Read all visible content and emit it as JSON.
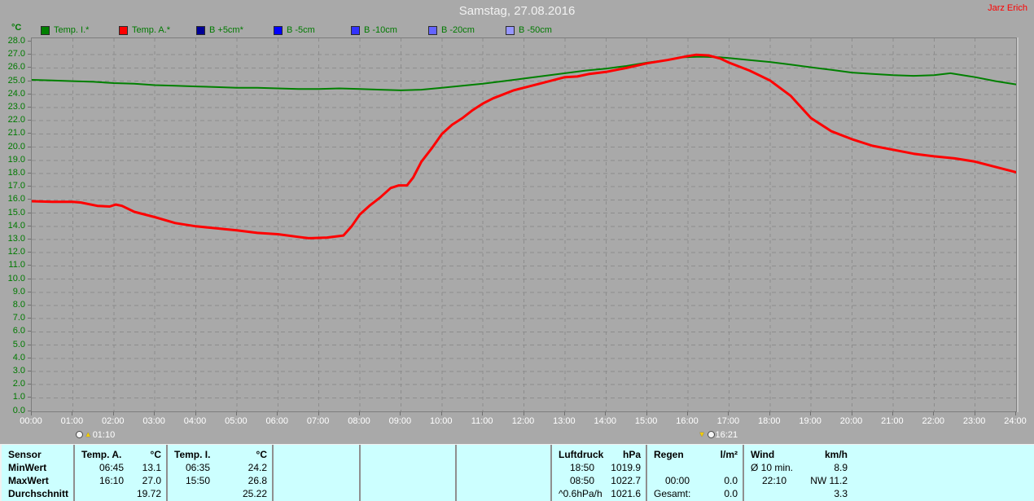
{
  "header": {
    "title": "Samstag, 27.08.2016",
    "user": "Jarz Erich"
  },
  "legend": {
    "axis_unit": "°C",
    "items": [
      {
        "label": "Temp. I.*",
        "color": "#008000"
      },
      {
        "label": "Temp. A.*",
        "color": "#ff0000"
      },
      {
        "label": "B +5cm*",
        "color": "#000096"
      },
      {
        "label": "B -5cm",
        "color": "#0000ff"
      },
      {
        "label": "B -10cm",
        "color": "#3232ff"
      },
      {
        "label": "B -20cm",
        "color": "#6464ff"
      },
      {
        "label": "B -50cm",
        "color": "#9696ff"
      }
    ]
  },
  "glyphs": {
    "up": "▲",
    "down": "▼"
  },
  "chart_data": {
    "type": "line",
    "title": "Samstag, 27.08.2016",
    "ylabel": "°C",
    "ylim": [
      0,
      28
    ],
    "y_tick_step": 1,
    "xlim_hours": [
      0,
      24
    ],
    "grid": "dashed",
    "legend_position": "top",
    "y_tick_labels": [
      "28.0",
      "27.0",
      "26.0",
      "25.0",
      "24.0",
      "23.0",
      "22.0",
      "21.0",
      "20.0",
      "19.0",
      "18.0",
      "17.0",
      "16.0",
      "15.0",
      "14.0",
      "13.0",
      "12.0",
      "11.0",
      "10.0",
      "9.0",
      "8.0",
      "7.0",
      "6.0",
      "5.0",
      "4.0",
      "3.0",
      "2.0",
      "1.0",
      "0.0"
    ],
    "x_tick_labels": [
      "00:00",
      "01:00",
      "02:00",
      "03:00",
      "04:00",
      "05:00",
      "06:00",
      "07:00",
      "08:00",
      "09:00",
      "10:00",
      "11:00",
      "12:00",
      "13:00",
      "14:00",
      "15:00",
      "16:00",
      "17:00",
      "18:00",
      "19:00",
      "20:00",
      "21:00",
      "22:00",
      "23:00",
      "24:00"
    ],
    "series": [
      {
        "name": "Temp. I.*",
        "color": "#008000",
        "width": 2,
        "points": [
          [
            0,
            25.1
          ],
          [
            0.5,
            25.05
          ],
          [
            1,
            25.0
          ],
          [
            1.5,
            24.95
          ],
          [
            2,
            24.85
          ],
          [
            2.5,
            24.8
          ],
          [
            3,
            24.7
          ],
          [
            3.5,
            24.65
          ],
          [
            4,
            24.6
          ],
          [
            4.5,
            24.55
          ],
          [
            5,
            24.5
          ],
          [
            5.5,
            24.5
          ],
          [
            6,
            24.45
          ],
          [
            6.5,
            24.4
          ],
          [
            7,
            24.4
          ],
          [
            7.5,
            24.45
          ],
          [
            8,
            24.4
          ],
          [
            8.5,
            24.35
          ],
          [
            9,
            24.3
          ],
          [
            9.5,
            24.35
          ],
          [
            10,
            24.5
          ],
          [
            10.5,
            24.65
          ],
          [
            11,
            24.8
          ],
          [
            11.5,
            25.0
          ],
          [
            12,
            25.2
          ],
          [
            12.5,
            25.4
          ],
          [
            13,
            25.6
          ],
          [
            13.5,
            25.8
          ],
          [
            14,
            25.95
          ],
          [
            14.5,
            26.15
          ],
          [
            15,
            26.4
          ],
          [
            15.5,
            26.6
          ],
          [
            15.8,
            26.8
          ],
          [
            16.3,
            26.85
          ],
          [
            16.8,
            26.8
          ],
          [
            17,
            26.75
          ],
          [
            17.5,
            26.6
          ],
          [
            18,
            26.45
          ],
          [
            18.5,
            26.25
          ],
          [
            19,
            26.05
          ],
          [
            19.5,
            25.85
          ],
          [
            20,
            25.65
          ],
          [
            20.5,
            25.55
          ],
          [
            21,
            25.45
          ],
          [
            21.5,
            25.4
          ],
          [
            22,
            25.45
          ],
          [
            22.4,
            25.6
          ],
          [
            22.8,
            25.4
          ],
          [
            23,
            25.3
          ],
          [
            23.5,
            25.0
          ],
          [
            24,
            24.75
          ]
        ]
      },
      {
        "name": "Temp. A.*",
        "color": "#ff0000",
        "width": 3,
        "points": [
          [
            0,
            15.9
          ],
          [
            0.5,
            15.85
          ],
          [
            1,
            15.85
          ],
          [
            1.2,
            15.8
          ],
          [
            1.6,
            15.55
          ],
          [
            1.9,
            15.5
          ],
          [
            2.05,
            15.65
          ],
          [
            2.2,
            15.55
          ],
          [
            2.5,
            15.1
          ],
          [
            3,
            14.7
          ],
          [
            3.5,
            14.25
          ],
          [
            4,
            14.0
          ],
          [
            4.5,
            13.85
          ],
          [
            5,
            13.7
          ],
          [
            5.5,
            13.5
          ],
          [
            6,
            13.4
          ],
          [
            6.5,
            13.2
          ],
          [
            6.75,
            13.1
          ],
          [
            7.2,
            13.15
          ],
          [
            7.6,
            13.3
          ],
          [
            7.8,
            14.0
          ],
          [
            8,
            14.9
          ],
          [
            8.25,
            15.6
          ],
          [
            8.5,
            16.2
          ],
          [
            8.75,
            16.9
          ],
          [
            8.95,
            17.1
          ],
          [
            9.15,
            17.1
          ],
          [
            9.3,
            17.7
          ],
          [
            9.5,
            18.9
          ],
          [
            9.75,
            19.9
          ],
          [
            10,
            21.0
          ],
          [
            10.25,
            21.7
          ],
          [
            10.5,
            22.2
          ],
          [
            10.75,
            22.8
          ],
          [
            11,
            23.3
          ],
          [
            11.25,
            23.7
          ],
          [
            11.5,
            24.0
          ],
          [
            11.75,
            24.3
          ],
          [
            12,
            24.5
          ],
          [
            12.5,
            24.9
          ],
          [
            13,
            25.3
          ],
          [
            13.3,
            25.35
          ],
          [
            13.6,
            25.55
          ],
          [
            14,
            25.7
          ],
          [
            14.5,
            26.0
          ],
          [
            15,
            26.35
          ],
          [
            15.5,
            26.6
          ],
          [
            16,
            26.9
          ],
          [
            16.2,
            27.0
          ],
          [
            16.5,
            26.95
          ],
          [
            16.8,
            26.7
          ],
          [
            17,
            26.4
          ],
          [
            17.5,
            25.8
          ],
          [
            18,
            25.05
          ],
          [
            18.5,
            23.9
          ],
          [
            19,
            22.2
          ],
          [
            19.5,
            21.2
          ],
          [
            20,
            20.6
          ],
          [
            20.5,
            20.1
          ],
          [
            21,
            19.8
          ],
          [
            21.5,
            19.5
          ],
          [
            22,
            19.3
          ],
          [
            22.5,
            19.15
          ],
          [
            23,
            18.9
          ],
          [
            23.5,
            18.5
          ],
          [
            24,
            18.1
          ]
        ]
      }
    ],
    "event_markers": [
      {
        "time": "01:10",
        "hours": 1.1667,
        "direction": "up"
      },
      {
        "time": "16:21",
        "hours": 16.35,
        "direction": "down"
      }
    ]
  },
  "summary_table": {
    "row_labels": [
      "Sensor",
      "MinWert",
      "MaxWert",
      "Durchschnitt"
    ],
    "temp_a": {
      "header": "Temp. A.",
      "unit": "°C",
      "min_time": "06:45",
      "min_value": "13.1",
      "max_time": "16:10",
      "max_value": "27.0",
      "avg": "19.72"
    },
    "temp_i": {
      "header": "Temp. I.",
      "unit": "°C",
      "min_time": "06:35",
      "min_value": "24.2",
      "max_time": "15:50",
      "max_value": "26.8",
      "avg": "25.22"
    },
    "luftdruck": {
      "header": "Luftdruck",
      "unit": "hPa",
      "min_time": "18:50",
      "min_value": "1019.9",
      "max_time": "08:50",
      "max_value": "1022.7",
      "tendency": "^0.6hPa/h",
      "avg": "1021.6"
    },
    "regen": {
      "header": "Regen",
      "unit": "l/m²",
      "max_time": "00:00",
      "max_value": "0.0",
      "total_label": "Gesamt:",
      "total_value": "0.0"
    },
    "wind": {
      "header": "Wind",
      "unit": "km/h",
      "min_label": "Ø 10 min.",
      "min_value": "8.9",
      "max_time": "22:10",
      "max_value": "NW 11.2",
      "avg": "3.3"
    }
  }
}
